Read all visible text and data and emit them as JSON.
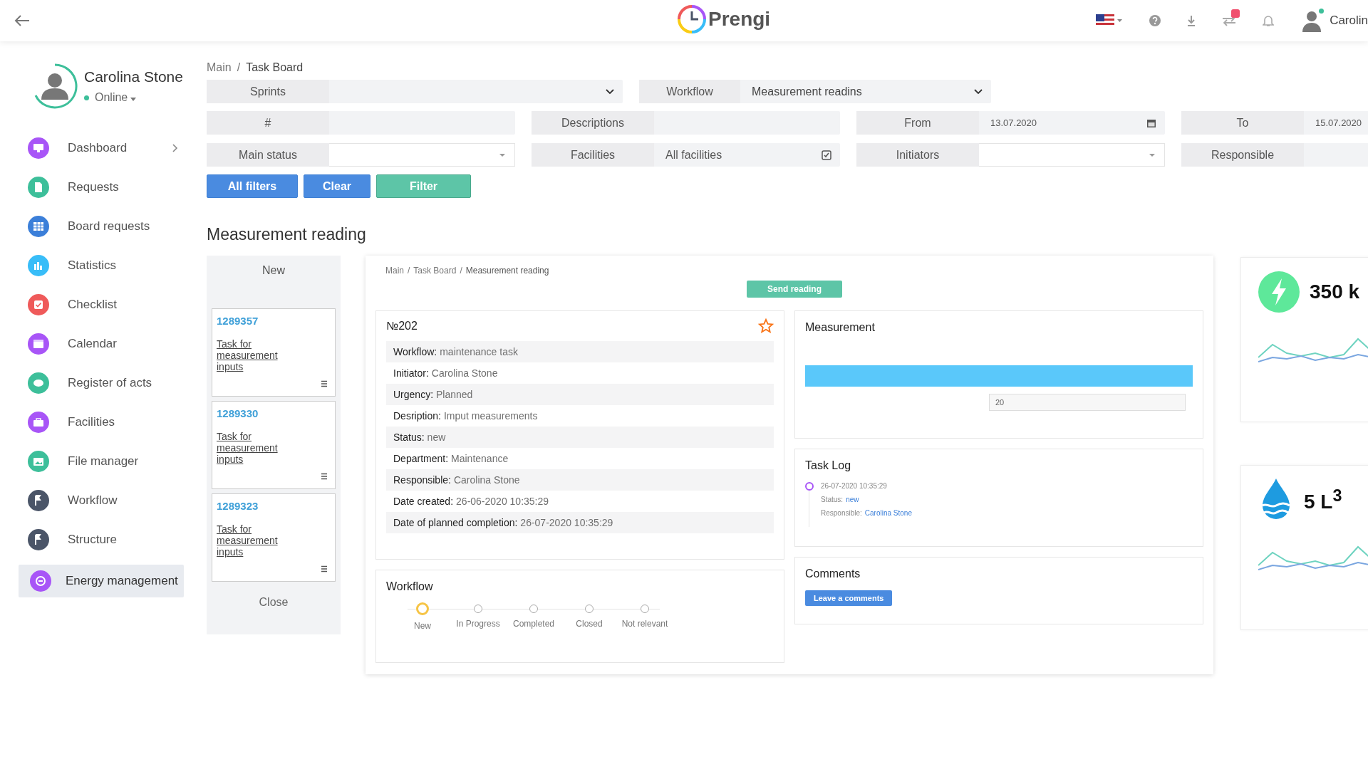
{
  "top_bar": {
    "logo": "Prengi",
    "user_name": "Carolin",
    "notification_badge": true
  },
  "profile": {
    "name": "Carolina Stone",
    "status": "Online"
  },
  "sidebar": {
    "items": [
      {
        "label": "Dashboard",
        "color": "#a855f7",
        "selected": false,
        "expandable": true
      },
      {
        "label": "Requests",
        "color": "#3dbf9a",
        "selected": false,
        "expandable": false
      },
      {
        "label": "Board requests",
        "color": "#3b7fd9",
        "selected": false,
        "expandable": false
      },
      {
        "label": "Statistics",
        "color": "#38bdf8",
        "selected": false,
        "expandable": false
      },
      {
        "label": "Checklist",
        "color": "#ef5a5a",
        "selected": false,
        "expandable": false
      },
      {
        "label": "Calendar",
        "color": "#a855f7",
        "selected": false,
        "expandable": false
      },
      {
        "label": "Register of acts",
        "color": "#3dbf9a",
        "selected": false,
        "expandable": false
      },
      {
        "label": "Facilities",
        "color": "#a855f7",
        "selected": false,
        "expandable": false
      },
      {
        "label": "File manager",
        "color": "#3dbf9a",
        "selected": false,
        "expandable": false
      },
      {
        "label": "Workflow",
        "color": "#4b5568",
        "selected": false,
        "expandable": false
      },
      {
        "label": "Structure",
        "color": "#4b5568",
        "selected": false,
        "expandable": false
      },
      {
        "label": "Energy management",
        "color": "#a855f7",
        "selected": true,
        "expandable": false
      }
    ]
  },
  "breadcrumb": [
    "Main",
    "Task Board"
  ],
  "breadcrumb_separator": "/",
  "filters": {
    "top": [
      {
        "label": "Sprints",
        "kind": "select"
      },
      {
        "label": "Workflow",
        "kind": "select",
        "value": "Measurement readins"
      }
    ],
    "grid": [
      {
        "label": "#",
        "kind": "text"
      },
      {
        "label": "Descriptions",
        "kind": "text"
      },
      {
        "label": "From",
        "kind": "date",
        "value": "13.07.2020"
      },
      {
        "label": "To",
        "kind": "text",
        "value": "15.07.2020"
      },
      {
        "label": "Main status",
        "kind": "dropdown"
      },
      {
        "label": "Facilities",
        "kind": "check",
        "value": "All facilities"
      },
      {
        "label": "Initiators",
        "kind": "dropdown"
      },
      {
        "label": "Responsible",
        "kind": "text"
      }
    ]
  },
  "buttons": [
    {
      "label": "All filters",
      "kind": "primary"
    },
    {
      "label": "Clear",
      "kind": "primary"
    },
    {
      "label": "Filter",
      "kind": "success"
    }
  ],
  "section_title": "Measurement reading",
  "column": {
    "title": "New",
    "cards": [
      {
        "number": "1289357",
        "title": "Task for measurement inputs"
      },
      {
        "number": "1289330",
        "title": "Task for measurement inputs"
      },
      {
        "number": "1289323",
        "title": "Task for measurement inputs"
      }
    ],
    "footer": "Close"
  },
  "detail": {
    "breadcrumb": [
      "Main",
      "Task Board",
      "Measurement reading"
    ],
    "breadcrumb_separator": "/",
    "send_button": "Send reading",
    "task": {
      "number": "№202",
      "starred": false,
      "fields": [
        {
          "label": "Workflow:",
          "value": "maintenance task"
        },
        {
          "label": "Initiator:",
          "value": "Carolina Stone"
        },
        {
          "label": "Urgency:",
          "value": "Planned"
        },
        {
          "label": "Desription:",
          "value": "Imput measurements"
        },
        {
          "label": "Status:",
          "value": "new"
        },
        {
          "label": "Department:",
          "value": "Maintenance"
        },
        {
          "label": "Responsible:",
          "value": "Carolina Stone"
        },
        {
          "label": "Date created:",
          "value": "26-06-2020  10:35:29"
        },
        {
          "label": "Date of planned completion:",
          "value": "26-07-2020  10:35:29"
        }
      ]
    },
    "workflow": {
      "title": "Workflow",
      "steps": [
        {
          "label": "New",
          "selected": true
        },
        {
          "label": "In Progress",
          "selected": false
        },
        {
          "label": "Completed",
          "selected": false
        },
        {
          "label": "Closed",
          "selected": false
        },
        {
          "label": "Not relevant",
          "selected": false
        }
      ]
    },
    "measurement": {
      "title": "Measurement",
      "input_value": "20"
    },
    "task_log": {
      "title": "Task Log",
      "entries": [
        {
          "time": "26-07-2020  10:35:29",
          "status_label": "Status:",
          "status": "new",
          "responsible_label": "Responsible:",
          "responsible": "Carolina Stone"
        }
      ]
    },
    "comments": {
      "title": "Comments",
      "button": "Leave a comments"
    }
  },
  "widgets": [
    {
      "kind": "energy",
      "reading": "350 k"
    },
    {
      "kind": "water",
      "reading": "5 L$^{3}$"
    }
  ]
}
